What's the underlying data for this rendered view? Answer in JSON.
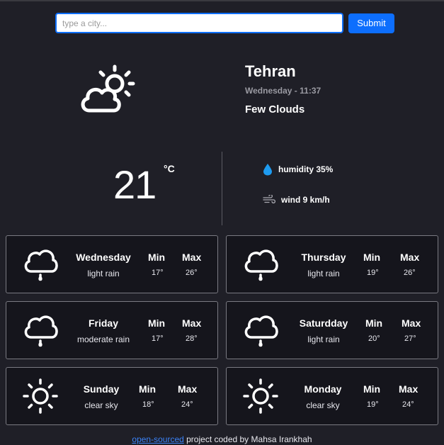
{
  "search": {
    "placeholder": "type a city...",
    "submit_label": "Submit"
  },
  "current": {
    "city": "Tehran",
    "datetime": "Wednesday - 11:37",
    "condition": "Few Clouds",
    "temperature": "21",
    "unit": "°C",
    "humidity": "humidity 35%",
    "wind": "wind 9 km/h",
    "icon": "few-clouds-icon"
  },
  "forecast": [
    {
      "day": "Wednesday",
      "desc": "light rain",
      "min_label": "Min",
      "max_label": "Max",
      "min": "17°",
      "max": "26°",
      "icon": "rain-cloud-icon"
    },
    {
      "day": "Thursday",
      "desc": "light rain",
      "min_label": "Min",
      "max_label": "Max",
      "min": "19°",
      "max": "26°",
      "icon": "rain-cloud-icon"
    },
    {
      "day": "Friday",
      "desc": "moderate rain",
      "min_label": "Min",
      "max_label": "Max",
      "min": "17°",
      "max": "28°",
      "icon": "rain-cloud-icon"
    },
    {
      "day": "Saturdday",
      "desc": "light rain",
      "min_label": "Min",
      "max_label": "Max",
      "min": "20°",
      "max": "27°",
      "icon": "rain-cloud-icon"
    },
    {
      "day": "Sunday",
      "desc": "clear sky",
      "min_label": "Min",
      "max_label": "Max",
      "min": "18°",
      "max": "24°",
      "icon": "sun-icon"
    },
    {
      "day": "Monday",
      "desc": "clear sky",
      "min_label": "Min",
      "max_label": "Max",
      "min": "19°",
      "max": "24°",
      "icon": "sun-icon"
    }
  ],
  "footer": {
    "link_text": "open-sourced",
    "text": " project coded by Mahsa Irankhah"
  },
  "colors": {
    "background": "#1f1f27",
    "card_bg": "#15151c",
    "accent": "#0d6efd",
    "humidity_drop": "#1e9bf0"
  }
}
